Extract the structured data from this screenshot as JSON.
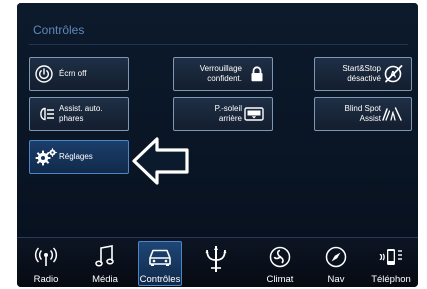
{
  "section": {
    "title": "Contrôles"
  },
  "tiles": {
    "screen_off": {
      "label": "Écrn off",
      "icon": "power-icon"
    },
    "auto_headlights": {
      "label_line1": "Assist. auto.",
      "label_line2": "phares",
      "icon": "headlight-icon"
    },
    "settings": {
      "label": "Réglages",
      "icon": "gears-icon",
      "active": true
    },
    "confidential_lock": {
      "label_line1": "Verrouillage",
      "label_line2": "confident.",
      "icon": "lock-icon"
    },
    "rear_sunshade": {
      "label_line1": "P.-soleil",
      "label_line2": "arrière",
      "icon": "sunshade-icon"
    },
    "start_stop": {
      "label_line1": "Start&Stop",
      "label_line2": "désactivé",
      "icon": "start-stop-off-icon"
    },
    "blind_spot": {
      "label_line1": "Blind Spot",
      "label_line2": "Assist",
      "icon": "blind-spot-icon"
    }
  },
  "pointer": {
    "icon": "left-arrow-icon",
    "color": "#ffffff"
  },
  "navbar": {
    "items": [
      {
        "label": "Radio",
        "icon": "radio-icon"
      },
      {
        "label": "Média",
        "icon": "music-note-icon"
      },
      {
        "label": "Contrôles",
        "icon": "car-icon",
        "active": true
      },
      {
        "label": "",
        "icon": "trident-logo-icon"
      },
      {
        "label": "Climat",
        "icon": "climate-fan-icon"
      },
      {
        "label": "Nav",
        "icon": "compass-icon"
      },
      {
        "label": "Téléphon",
        "icon": "phone-icon"
      }
    ]
  },
  "colors": {
    "background": "#0a1626",
    "accent": "#4c86c9",
    "title": "#5f89b8",
    "text": "#ffffff"
  }
}
